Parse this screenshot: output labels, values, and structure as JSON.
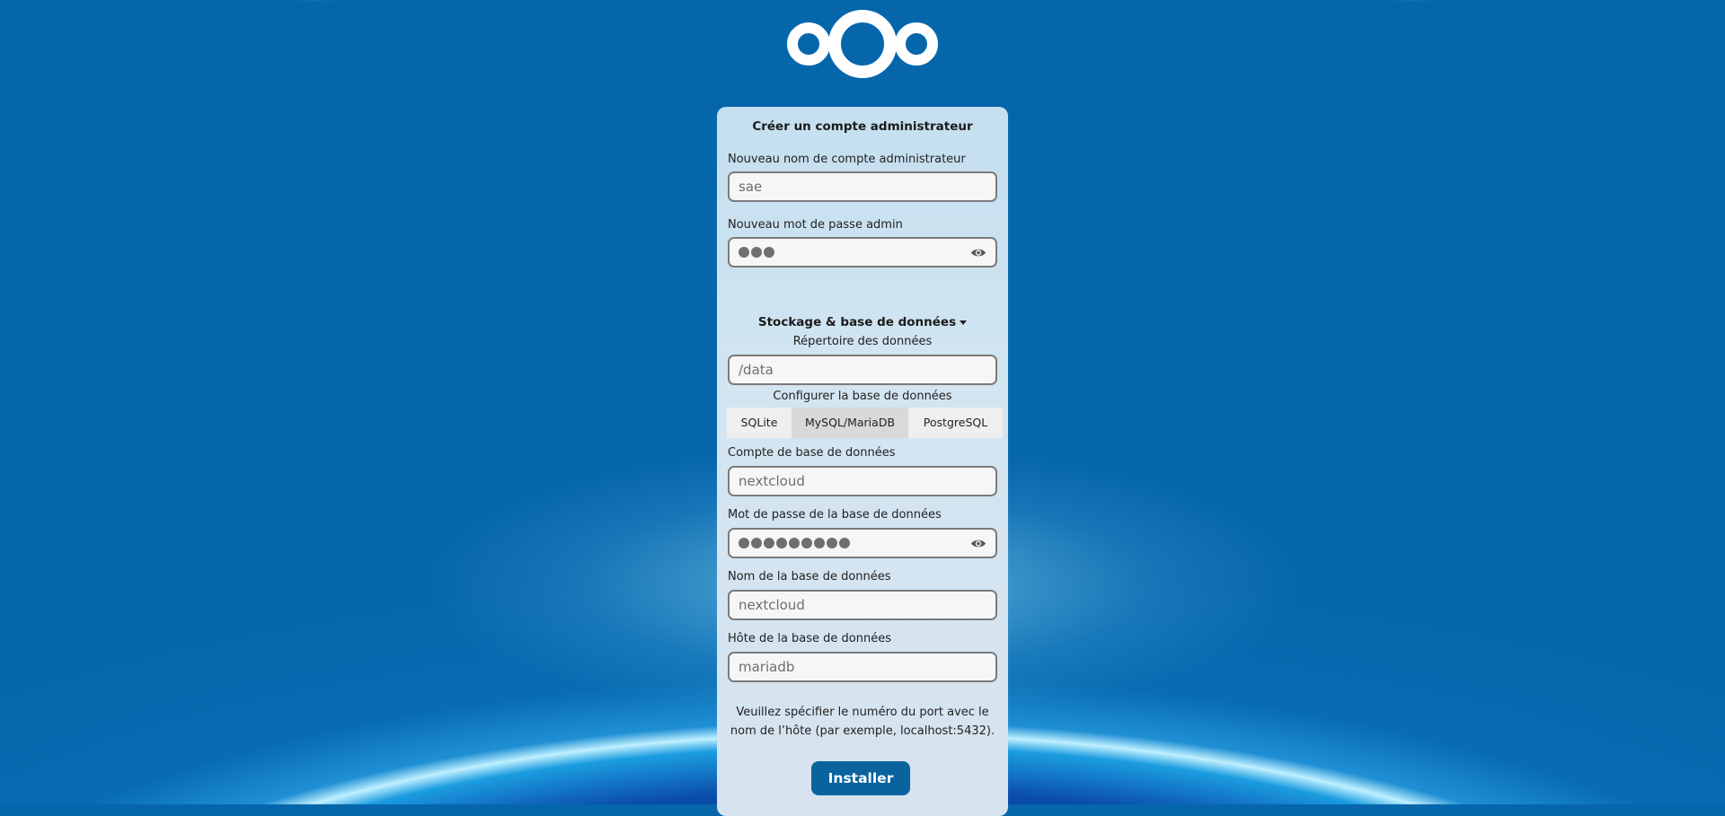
{
  "form": {
    "title": "Créer un compte administrateur",
    "admin_user_label": "Nouveau nom de compte administrateur",
    "admin_user_value": "sae",
    "admin_password_label": "Nouveau mot de passe admin",
    "admin_password_dots": 3,
    "storage_section_label": "Stockage & base de données",
    "data_dir_label": "Répertoire des données",
    "data_dir_value": "/data",
    "db_config_label": "Configurer la base de données",
    "db_tabs": [
      {
        "label": "SQLite",
        "active": false
      },
      {
        "label": "MySQL/MariaDB",
        "active": true
      },
      {
        "label": "PostgreSQL",
        "active": false
      }
    ],
    "db_user_label": "Compte de base de données",
    "db_user_value": "nextcloud",
    "db_password_label": "Mot de passe de la base de données",
    "db_password_dots": 9,
    "db_name_label": "Nom de la base de données",
    "db_name_value": "nextcloud",
    "db_host_label": "Hôte de la base de données",
    "db_host_value": "mariadb",
    "hint_line1": "Veuillez spécifier le numéro du port avec le",
    "hint_line2": "nom de l’hôte (par exemple, localhost:5432).",
    "install_label": "Installer"
  },
  "icons": {
    "logo": "nextcloud-logo",
    "password_toggle": "eye-icon",
    "dropdown": "caret-down-icon"
  },
  "colors": {
    "primary_button": "#0a639d",
    "background": "#0667ab"
  }
}
